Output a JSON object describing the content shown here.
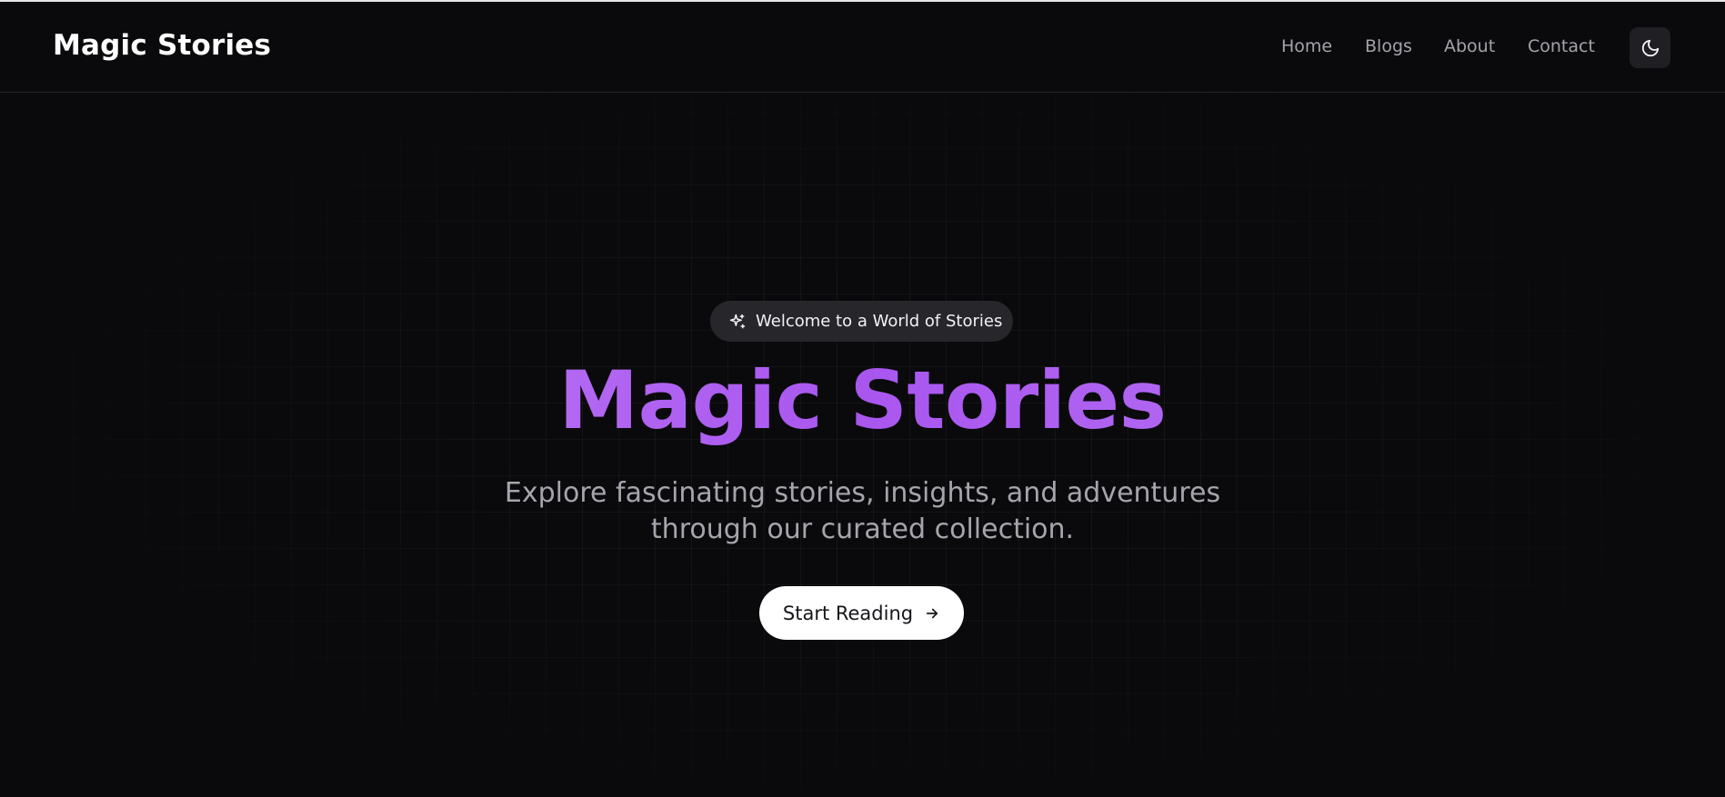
{
  "navbar": {
    "brand": "Magic Stories",
    "links": [
      {
        "label": "Home"
      },
      {
        "label": "Blogs"
      },
      {
        "label": "About"
      },
      {
        "label": "Contact"
      }
    ],
    "theme_toggle_icon": "moon-icon"
  },
  "hero": {
    "badge": {
      "icon": "sparkles-icon",
      "text": "Welcome to a World of Stories"
    },
    "title": "Magic Stories",
    "subtitle_line1": "Explore fascinating stories, insights, and adventures",
    "subtitle_line2": "through our curated collection.",
    "cta": {
      "label": "Start Reading",
      "icon": "arrow-right-icon"
    }
  },
  "colors": {
    "background": "#0a0a0c",
    "accent_gradient_start": "#c48af7",
    "accent_gradient_mid": "#a956ef",
    "text_muted": "#a5a5ad",
    "button_bg": "#ffffff"
  }
}
